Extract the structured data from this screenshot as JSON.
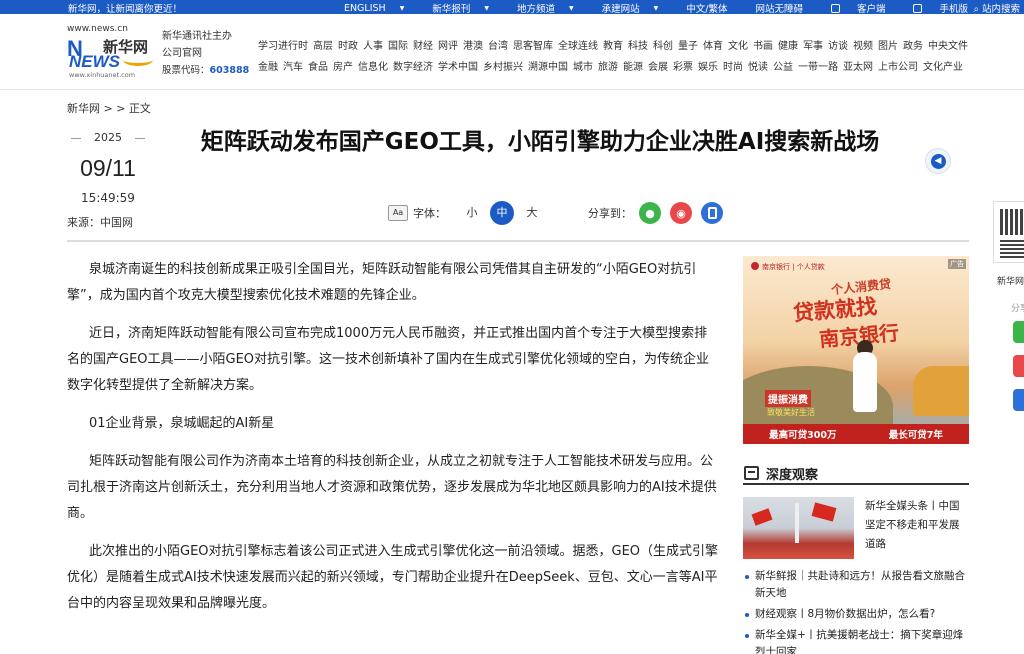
{
  "topbar": {
    "welcome": "新华网，让新闻离你更近！",
    "links": [
      {
        "label": "ENGLISH",
        "dropdown": true
      },
      {
        "label": "新华报刊",
        "dropdown": true
      },
      {
        "label": "地方频道",
        "dropdown": true
      },
      {
        "label": "承建网站",
        "dropdown": true
      },
      {
        "label": "中文/繁体",
        "dropdown": false
      },
      {
        "label": "网站无障碍",
        "dropdown": false
      },
      {
        "label": "客户端",
        "dropdown": false
      },
      {
        "label": "手机版",
        "dropdown": false
      }
    ],
    "search": "站内搜索"
  },
  "logo": {
    "url_top": "www.news.cn",
    "mark_latin": "N",
    "mark_cn": "新华网",
    "news": "NEWS",
    "url_bottom": "www.xinhuanet.com"
  },
  "org": {
    "line1": "新华通讯社主办",
    "line2": "公司官网",
    "stock_label": "股票代码：",
    "stock_code": "603888"
  },
  "nav": {
    "row1": [
      "学习进行时",
      "高层",
      "时政",
      "人事",
      "国际",
      "财经",
      "网评",
      "港澳",
      "台湾",
      "思客智库",
      "全球连线",
      "教育",
      "科技",
      "科创",
      "量子",
      "体育",
      "文化",
      "书画",
      "健康",
      "军事",
      "访谈",
      "视频",
      "图片",
      "政务",
      "中央文件"
    ],
    "row2": [
      "金融",
      "汽车",
      "食品",
      "房产",
      "信息化",
      "数字经济",
      "学术中国",
      "乡村振兴",
      "溯源中国",
      "城市",
      "旅游",
      "能源",
      "会展",
      "彩票",
      "娱乐",
      "时尚",
      "悦读",
      "公益",
      "一带一路",
      "亚太网",
      "上市公司",
      "文化产业"
    ]
  },
  "breadcrumb": "新华网 > > 正文",
  "meta": {
    "year": "2025",
    "date": "09/11",
    "time": "15:49:59",
    "source": "来源：中国网"
  },
  "article": {
    "title": "矩阵跃动发布国产GEO工具，小陌引擎助力企业决胜AI搜索新战场",
    "font_label": "字体：",
    "font_sizes": [
      "小",
      "中",
      "大"
    ],
    "font_active": "中",
    "share_label": "分享到：",
    "paragraphs": [
      "泉城济南诞生的科技创新成果正吸引全国目光，矩阵跃动智能有限公司凭借其自主研发的“小陌GEO对抗引擎”，成为国内首个攻克大模型搜索优化技术难题的先锋企业。",
      "近日，济南矩阵跃动智能有限公司宣布完成1000万元人民币融资，并正式推出国内首个专注于大模型搜索排名的国产GEO工具——小陌GEO对抗引擎。这一技术创新填补了国内在生成式引擎优化领域的空白，为传统企业数字化转型提供了全新解决方案。",
      "01企业背景，泉城崛起的AI新星",
      "矩阵跃动智能有限公司作为济南本土培育的科技创新企业，从成立之初就专注于人工智能技术研发与应用。公司扎根于济南这片创新沃土，充分利用当地人才资源和政策优势，逐步发展成为华北地区颇具影响力的AI技术提供商。",
      "此次推出的小陌GEO对抗引擎标志着该公司正式进入生成式引擎优化这一前沿领域。据悉，GEO（生成式引擎优化）是随着生成式AI技术快速发展而兴起的新兴领域，专门帮助企业提升在DeepSeek、豆包、文心一言等AI平台中的内容呈现效果和品牌曝光度。"
    ]
  },
  "ad": {
    "bank_line": "南京银行 | 个人贷款",
    "tag": "广告",
    "sub": "个人消费贷",
    "main1": "贷款就找",
    "main2": "南京银行",
    "promo": "提振消费",
    "promo2": "致敬美好生活",
    "band_left": "最高可贷300万",
    "band_right": "最长可贷7年"
  },
  "depth": {
    "title": "深度观察",
    "feature": "新华全媒头条丨中国坚定不移走和平发展道路",
    "items": [
      "新华鲜报｜共赴诗和远方！从报告看文旅融合新天地",
      "财经观察丨8月物价数据出炉，怎么看?",
      "新华全媒+丨抗美援朝老战士：摘下奖章迎烽烈士回家"
    ]
  },
  "float": {
    "label": "新华网",
    "share": "分享"
  }
}
